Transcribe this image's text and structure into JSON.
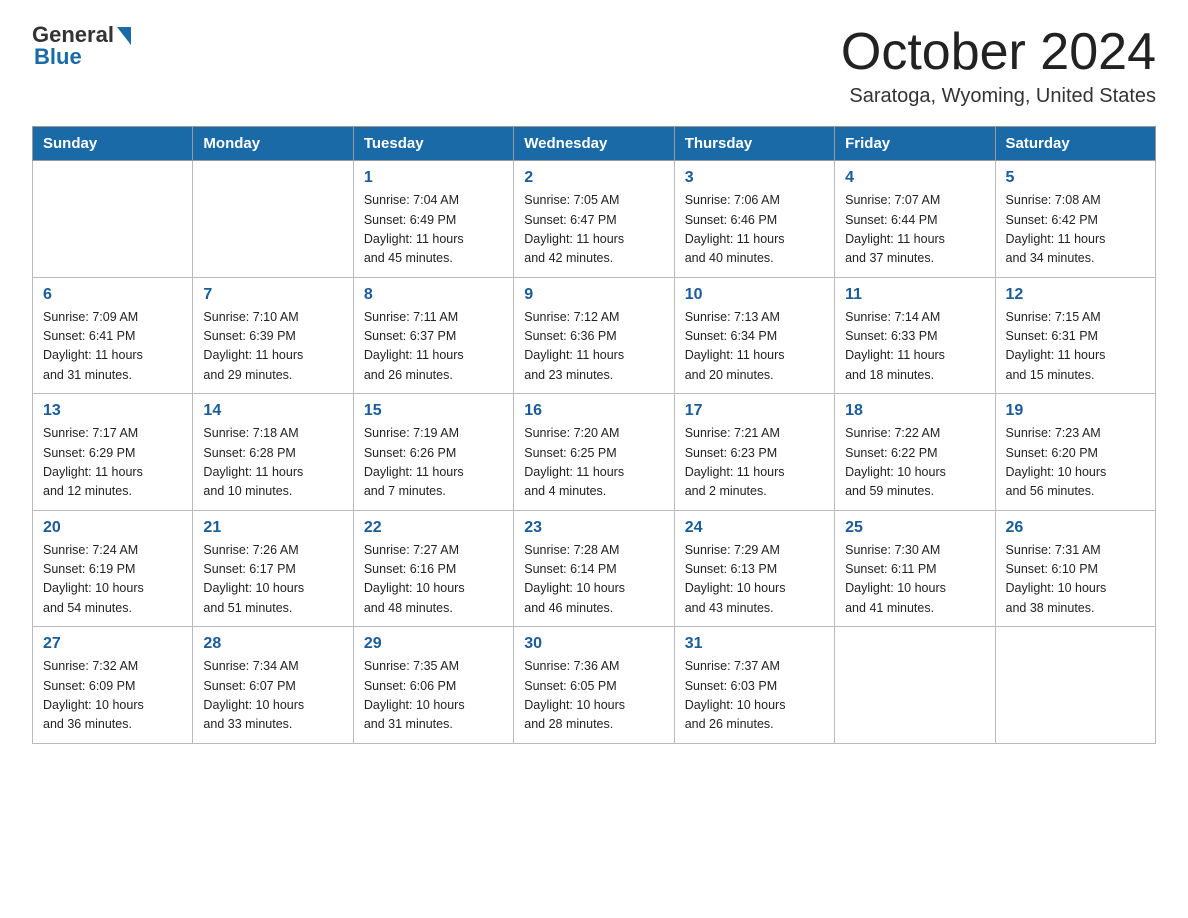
{
  "logo": {
    "general": "General",
    "blue": "Blue"
  },
  "title": "October 2024",
  "subtitle": "Saratoga, Wyoming, United States",
  "days_of_week": [
    "Sunday",
    "Monday",
    "Tuesday",
    "Wednesday",
    "Thursday",
    "Friday",
    "Saturday"
  ],
  "weeks": [
    [
      {
        "day": "",
        "info": ""
      },
      {
        "day": "",
        "info": ""
      },
      {
        "day": "1",
        "info": "Sunrise: 7:04 AM\nSunset: 6:49 PM\nDaylight: 11 hours\nand 45 minutes."
      },
      {
        "day": "2",
        "info": "Sunrise: 7:05 AM\nSunset: 6:47 PM\nDaylight: 11 hours\nand 42 minutes."
      },
      {
        "day": "3",
        "info": "Sunrise: 7:06 AM\nSunset: 6:46 PM\nDaylight: 11 hours\nand 40 minutes."
      },
      {
        "day": "4",
        "info": "Sunrise: 7:07 AM\nSunset: 6:44 PM\nDaylight: 11 hours\nand 37 minutes."
      },
      {
        "day": "5",
        "info": "Sunrise: 7:08 AM\nSunset: 6:42 PM\nDaylight: 11 hours\nand 34 minutes."
      }
    ],
    [
      {
        "day": "6",
        "info": "Sunrise: 7:09 AM\nSunset: 6:41 PM\nDaylight: 11 hours\nand 31 minutes."
      },
      {
        "day": "7",
        "info": "Sunrise: 7:10 AM\nSunset: 6:39 PM\nDaylight: 11 hours\nand 29 minutes."
      },
      {
        "day": "8",
        "info": "Sunrise: 7:11 AM\nSunset: 6:37 PM\nDaylight: 11 hours\nand 26 minutes."
      },
      {
        "day": "9",
        "info": "Sunrise: 7:12 AM\nSunset: 6:36 PM\nDaylight: 11 hours\nand 23 minutes."
      },
      {
        "day": "10",
        "info": "Sunrise: 7:13 AM\nSunset: 6:34 PM\nDaylight: 11 hours\nand 20 minutes."
      },
      {
        "day": "11",
        "info": "Sunrise: 7:14 AM\nSunset: 6:33 PM\nDaylight: 11 hours\nand 18 minutes."
      },
      {
        "day": "12",
        "info": "Sunrise: 7:15 AM\nSunset: 6:31 PM\nDaylight: 11 hours\nand 15 minutes."
      }
    ],
    [
      {
        "day": "13",
        "info": "Sunrise: 7:17 AM\nSunset: 6:29 PM\nDaylight: 11 hours\nand 12 minutes."
      },
      {
        "day": "14",
        "info": "Sunrise: 7:18 AM\nSunset: 6:28 PM\nDaylight: 11 hours\nand 10 minutes."
      },
      {
        "day": "15",
        "info": "Sunrise: 7:19 AM\nSunset: 6:26 PM\nDaylight: 11 hours\nand 7 minutes."
      },
      {
        "day": "16",
        "info": "Sunrise: 7:20 AM\nSunset: 6:25 PM\nDaylight: 11 hours\nand 4 minutes."
      },
      {
        "day": "17",
        "info": "Sunrise: 7:21 AM\nSunset: 6:23 PM\nDaylight: 11 hours\nand 2 minutes."
      },
      {
        "day": "18",
        "info": "Sunrise: 7:22 AM\nSunset: 6:22 PM\nDaylight: 10 hours\nand 59 minutes."
      },
      {
        "day": "19",
        "info": "Sunrise: 7:23 AM\nSunset: 6:20 PM\nDaylight: 10 hours\nand 56 minutes."
      }
    ],
    [
      {
        "day": "20",
        "info": "Sunrise: 7:24 AM\nSunset: 6:19 PM\nDaylight: 10 hours\nand 54 minutes."
      },
      {
        "day": "21",
        "info": "Sunrise: 7:26 AM\nSunset: 6:17 PM\nDaylight: 10 hours\nand 51 minutes."
      },
      {
        "day": "22",
        "info": "Sunrise: 7:27 AM\nSunset: 6:16 PM\nDaylight: 10 hours\nand 48 minutes."
      },
      {
        "day": "23",
        "info": "Sunrise: 7:28 AM\nSunset: 6:14 PM\nDaylight: 10 hours\nand 46 minutes."
      },
      {
        "day": "24",
        "info": "Sunrise: 7:29 AM\nSunset: 6:13 PM\nDaylight: 10 hours\nand 43 minutes."
      },
      {
        "day": "25",
        "info": "Sunrise: 7:30 AM\nSunset: 6:11 PM\nDaylight: 10 hours\nand 41 minutes."
      },
      {
        "day": "26",
        "info": "Sunrise: 7:31 AM\nSunset: 6:10 PM\nDaylight: 10 hours\nand 38 minutes."
      }
    ],
    [
      {
        "day": "27",
        "info": "Sunrise: 7:32 AM\nSunset: 6:09 PM\nDaylight: 10 hours\nand 36 minutes."
      },
      {
        "day": "28",
        "info": "Sunrise: 7:34 AM\nSunset: 6:07 PM\nDaylight: 10 hours\nand 33 minutes."
      },
      {
        "day": "29",
        "info": "Sunrise: 7:35 AM\nSunset: 6:06 PM\nDaylight: 10 hours\nand 31 minutes."
      },
      {
        "day": "30",
        "info": "Sunrise: 7:36 AM\nSunset: 6:05 PM\nDaylight: 10 hours\nand 28 minutes."
      },
      {
        "day": "31",
        "info": "Sunrise: 7:37 AM\nSunset: 6:03 PM\nDaylight: 10 hours\nand 26 minutes."
      },
      {
        "day": "",
        "info": ""
      },
      {
        "day": "",
        "info": ""
      }
    ]
  ]
}
